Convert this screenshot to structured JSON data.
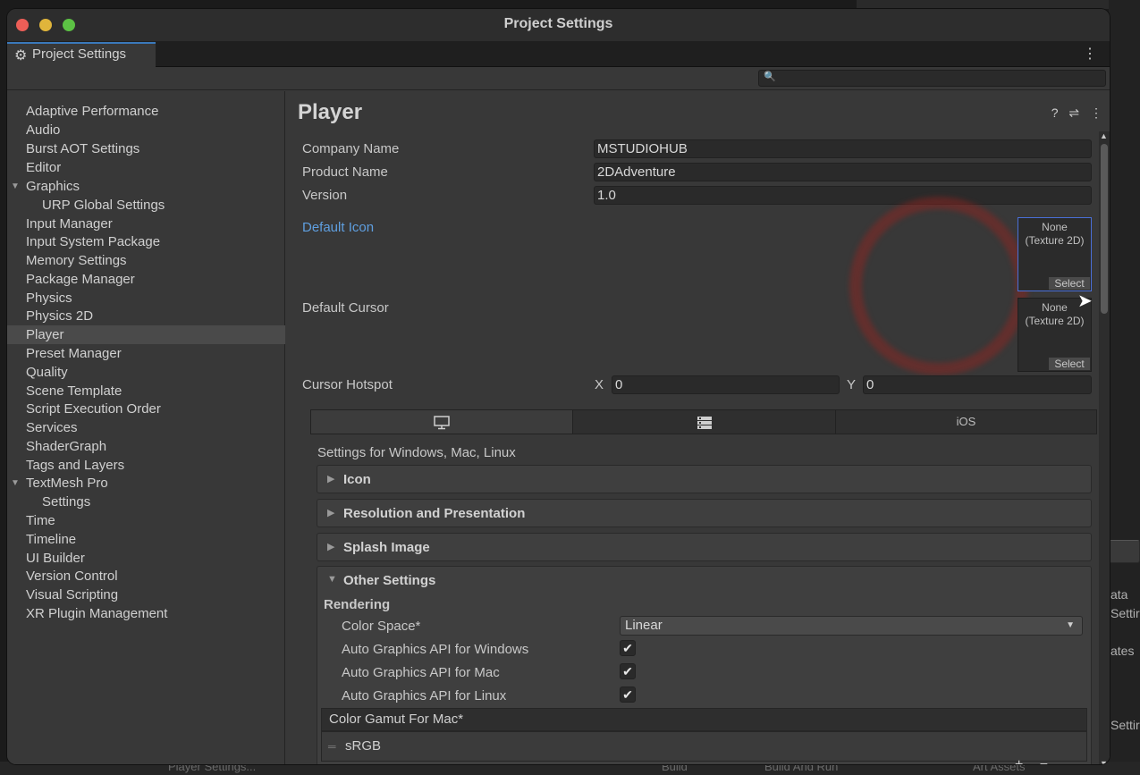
{
  "window": {
    "title": "Project Settings"
  },
  "colors": {
    "accent": "#3a79bb",
    "link": "#5f9fe0",
    "close": "#ec5e57",
    "minimize": "#e0b53b",
    "maximize": "#5cc244"
  },
  "tab": {
    "label": "Project Settings",
    "icon": "gear-icon"
  },
  "search": {
    "placeholder": ""
  },
  "sidebar": {
    "items": [
      {
        "label": "Adaptive Performance"
      },
      {
        "label": "Audio"
      },
      {
        "label": "Burst AOT Settings"
      },
      {
        "label": "Editor"
      },
      {
        "label": "Graphics",
        "expanded": true
      },
      {
        "label": "URP Global Settings",
        "child": true
      },
      {
        "label": "Input Manager"
      },
      {
        "label": "Input System Package"
      },
      {
        "label": "Memory Settings"
      },
      {
        "label": "Package Manager"
      },
      {
        "label": "Physics"
      },
      {
        "label": "Physics 2D"
      },
      {
        "label": "Player",
        "selected": true
      },
      {
        "label": "Preset Manager"
      },
      {
        "label": "Quality"
      },
      {
        "label": "Scene Template"
      },
      {
        "label": "Script Execution Order"
      },
      {
        "label": "Services"
      },
      {
        "label": "ShaderGraph"
      },
      {
        "label": "Tags and Layers"
      },
      {
        "label": "TextMesh Pro",
        "expanded": true
      },
      {
        "label": "Settings",
        "child": true
      },
      {
        "label": "Time"
      },
      {
        "label": "Timeline"
      },
      {
        "label": "UI Builder"
      },
      {
        "label": "Version Control"
      },
      {
        "label": "Visual Scripting"
      },
      {
        "label": "XR Plugin Management"
      }
    ]
  },
  "main": {
    "title": "Player",
    "company_label": "Company Name",
    "company_value": "MSTUDIOHUB",
    "product_label": "Product Name",
    "product_value": "2DAdventure",
    "version_label": "Version",
    "version_value": "1.0",
    "default_icon_label": "Default Icon",
    "default_icon": {
      "line1": "None",
      "line2": "(Texture 2D)",
      "select": "Select"
    },
    "default_cursor_label": "Default Cursor",
    "default_cursor": {
      "line1": "None",
      "line2": "(Texture 2D)",
      "select": "Select"
    },
    "hotspot_label": "Cursor Hotspot",
    "hotspot_x_label": "X",
    "hotspot_x": "0",
    "hotspot_y_label": "Y",
    "hotspot_y": "0",
    "platform_tabs": [
      {
        "icon": "monitor-icon"
      },
      {
        "icon": "server-icon"
      },
      {
        "label": "iOS"
      }
    ],
    "settings_for": "Settings for Windows, Mac, Linux",
    "panels": {
      "icon": "Icon",
      "resolution": "Resolution and Presentation",
      "splash": "Splash Image",
      "other": "Other Settings"
    },
    "rendering": {
      "header": "Rendering",
      "color_space_label": "Color Space*",
      "color_space_value": "Linear",
      "auto_windows_label": "Auto Graphics API  for Windows",
      "auto_windows": true,
      "auto_mac_label": "Auto Graphics API  for Mac",
      "auto_mac": true,
      "auto_linux_label": "Auto Graphics API  for Linux",
      "auto_linux": true,
      "gamut_label": "Color Gamut For Mac*",
      "gamut_items": [
        "sRGB"
      ]
    }
  },
  "background": {
    "right_fragments": [
      "ata",
      "Settir",
      "ates",
      "Settir"
    ],
    "bottom_fragments": [
      "Player Settings...",
      "Build",
      "Build And Run",
      "Art Assets"
    ]
  }
}
